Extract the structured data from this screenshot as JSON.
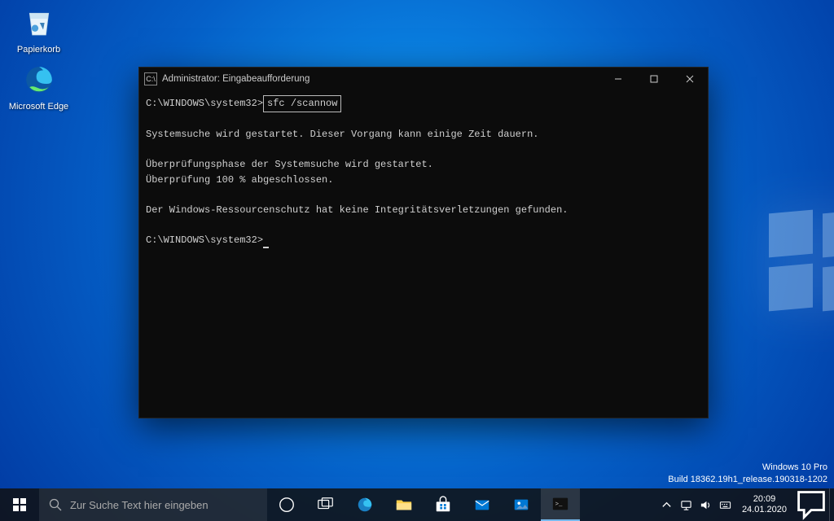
{
  "desktop": {
    "recycle_bin": "Papierkorb",
    "edge": "Microsoft Edge"
  },
  "cmd": {
    "title": "Administrator: Eingabeaufforderung",
    "prompt1_path": "C:\\WINDOWS\\system32>",
    "prompt1_cmd": "sfc /scannow",
    "line_blank1": "",
    "line2": "Systemsuche wird gestartet. Dieser Vorgang kann einige Zeit dauern.",
    "line3": "Überprüfungsphase der Systemsuche wird gestartet.",
    "line4": "Überprüfung 100 % abgeschlossen.",
    "line5": "Der Windows-Ressourcenschutz hat keine Integritätsverletzungen gefunden.",
    "prompt2": "C:\\WINDOWS\\system32>"
  },
  "watermark": {
    "line1": "Windows 10 Pro",
    "line2": "Build 18362.19h1_release.190318-1202"
  },
  "taskbar": {
    "search_placeholder": "Zur Suche Text hier eingeben"
  },
  "clock": {
    "time": "20:09",
    "date": "24.01.2020"
  }
}
